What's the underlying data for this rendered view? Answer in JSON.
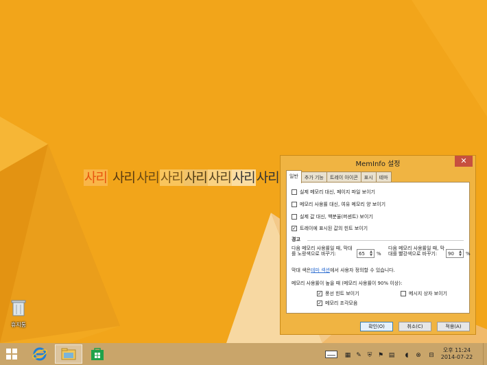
{
  "desktop": {
    "recycle_bin_label": "휴지통",
    "marquee_text": [
      "사리",
      "사리",
      "사리",
      "사리",
      "사리",
      "사리",
      "사리",
      "사리"
    ]
  },
  "dialog": {
    "title": "MemInfo 설정",
    "close_symbol": "✕",
    "tabs": [
      "일반",
      "추가 기능",
      "트레이 아이콘",
      "표시",
      "테마"
    ],
    "options": [
      {
        "label": "실제 메모리 대신, 페이지 파일 보이기",
        "checked": false
      },
      {
        "label": "메모리 사용률 대신, 여유 메모리 양 보이기",
        "checked": false
      },
      {
        "label": "실제 값 대신, 백분율(퍼센트) 보이기",
        "checked": false
      },
      {
        "label": "트레이에 표시된 값의 힌트 보이기",
        "checked": true
      }
    ],
    "warning_section": "경고",
    "yellow_label": "다음 메모리 사용률일 때, 막대를 노랑색으로 바꾸기:",
    "yellow_value": "65",
    "red_label": "다음 메모리 사용률일 때, 막대를 빨강색으로 바꾸기:",
    "red_value": "90",
    "percent": "%",
    "color_note_pre": "막대 색은 ",
    "color_note_link": "테마 섹션",
    "color_note_post": "에서 사용자 정의할 수 있습니다.",
    "high_usage_label": "메모리 사용률이 높을 때 (메모리 사용률이 90% 이상):",
    "high_options": [
      {
        "label": "풍선 힌트 보이기",
        "checked": true
      },
      {
        "label": "메시지 상자 보이기",
        "checked": false
      },
      {
        "label": "메모리 조각모음",
        "checked": true
      }
    ],
    "buttons": {
      "ok": "확인(O)",
      "cancel": "취소(C)",
      "apply": "적용(A)"
    }
  },
  "taskbar": {
    "clock_time": "오후 11:24",
    "clock_date": "2014-07-22"
  },
  "colors": {
    "desktop": "#f2a51a",
    "dialog_frame": "#f0b442",
    "close_button": "#c7503f",
    "taskbar": "#c9a56a"
  }
}
